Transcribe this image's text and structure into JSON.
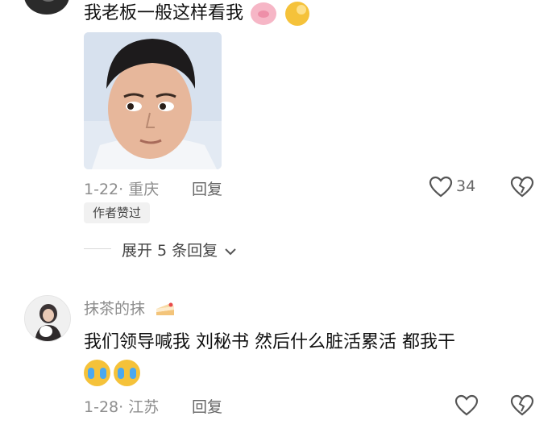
{
  "comment1": {
    "text": "我老板一般这样看我",
    "emojis": [
      "pig-face",
      "peeking-face"
    ],
    "meta": "1-22· 重庆",
    "reply_label": "回复",
    "like_count": "34",
    "author_liked_badge": "作者赞过"
  },
  "expand_replies": {
    "label": "展开 5 条回复"
  },
  "comment2": {
    "username": "抹茶的抹",
    "user_emoji": "cake-slice",
    "text": "我们领导喊我 刘秘书  然后什么脏活累活  都我干",
    "emojis": [
      "crying-laughing-face",
      "crying-laughing-face"
    ],
    "meta": "1-28· 江苏",
    "reply_label": "回复"
  }
}
